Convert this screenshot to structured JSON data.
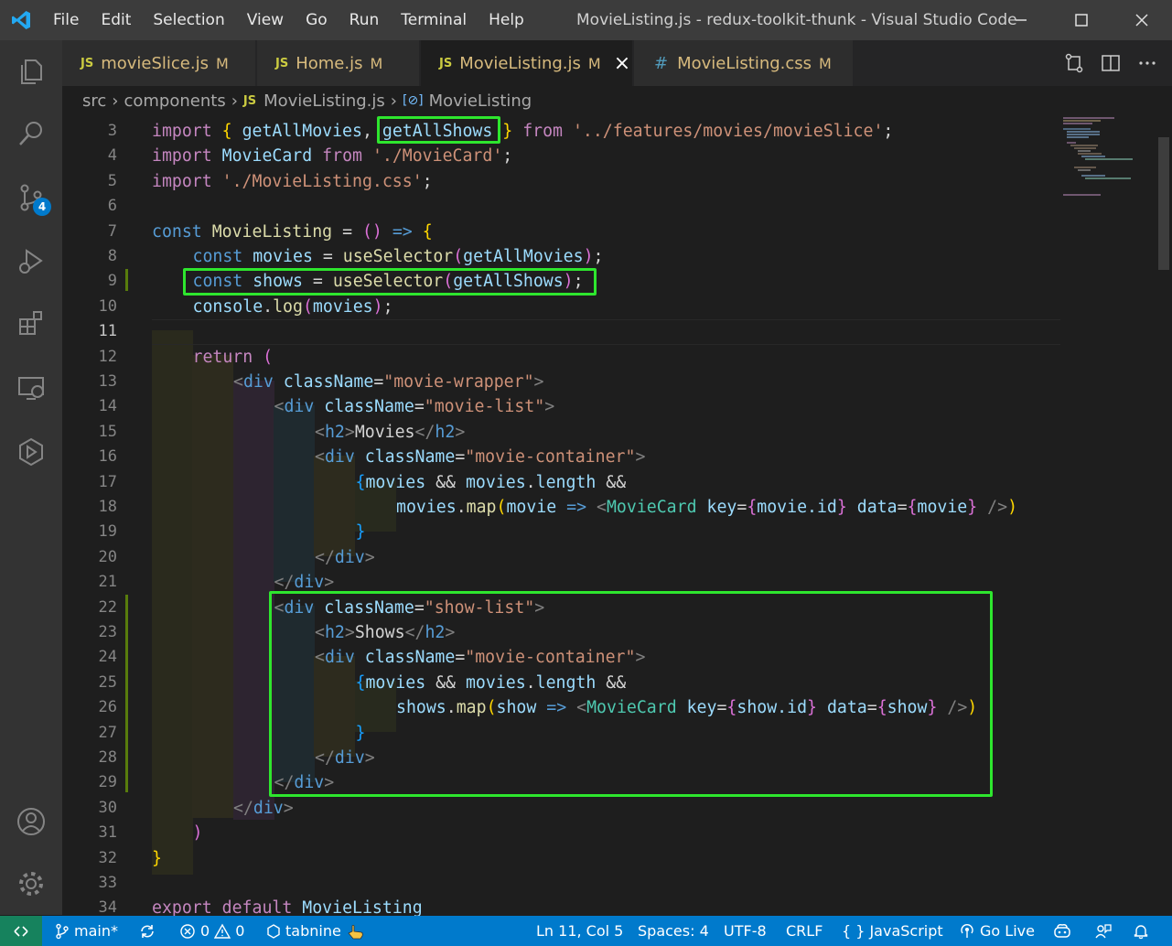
{
  "window": {
    "title": "MovieListing.js - redux-toolkit-thunk - Visual Studio Code"
  },
  "menu": [
    "File",
    "Edit",
    "Selection",
    "View",
    "Go",
    "Run",
    "Terminal",
    "Help"
  ],
  "activity_bar": {
    "source_control_badge": "4"
  },
  "tabs": [
    {
      "icon": "JS",
      "label": "movieSlice.js",
      "status": "M",
      "active": false
    },
    {
      "icon": "JS",
      "label": "Home.js",
      "status": "M",
      "active": false
    },
    {
      "icon": "JS",
      "label": "MovieListing.js",
      "status": "M",
      "active": true
    },
    {
      "icon": "#",
      "label": "MovieListing.css",
      "status": "M",
      "active": false
    }
  ],
  "breadcrumb": {
    "parts": [
      "src",
      "components",
      "MovieListing.js",
      "MovieListing"
    ],
    "file_icon": "JS"
  },
  "editor": {
    "current_line": 11,
    "line_numbers": [
      "3",
      "4",
      "5",
      "6",
      "7",
      "8",
      "9",
      "10",
      "11",
      "12",
      "13",
      "14",
      "15",
      "16",
      "17",
      "18",
      "19",
      "20",
      "21",
      "22",
      "23",
      "24",
      "25",
      "26",
      "27",
      "28",
      "29",
      "30",
      "31",
      "32",
      "33",
      "34"
    ],
    "code": {
      "l3_import": "import",
      "l3_open": "{",
      "l3_getAllMovies": "getAllMovies",
      "l3_comma": ",",
      "l3_getAllShows": "getAllShows",
      "l3_close": "}",
      "l3_from": "from",
      "l3_path": "'../features/movies/movieSlice'",
      "l3_semi": ";",
      "l4_import": "import",
      "l4_name": "MovieCard",
      "l4_from": "from",
      "l4_path": "'./MovieCard'",
      "l4_semi": ";",
      "l5_import": "import",
      "l5_path": "'./MovieListing.css'",
      "l5_semi": ";",
      "l7_const": "const",
      "l7_name": "MovieListing",
      "l7_eq": "=",
      "l7_parens": "()",
      "l7_arrow": "=>",
      "l7_brace": "{",
      "l8_const": "const",
      "l8_var": "movies",
      "l8_eq": "=",
      "l8_fn": "useSelector",
      "l8_arg": "getAllMovies",
      "l8_end": ");",
      "l9_const": "const",
      "l9_var": "shows",
      "l9_eq": "=",
      "l9_fn": "useSelector",
      "l9_arg": "getAllShows",
      "l9_end": ");",
      "l10_console": "console",
      "l10_log": "log",
      "l10_arg": "movies",
      "l10_end": ");",
      "l12_return": "return",
      "l12_paren": "(",
      "l13_class": "\"movie-wrapper\"",
      "l14_class": "\"movie-list\"",
      "l15_text": "Movies",
      "l16_class": "\"movie-container\"",
      "l17_movies": "movies",
      "l17_and": "&&",
      "l17_movies2": "movies",
      "l17_length": "length",
      "l17_and2": "&&",
      "l18_movies": "movies",
      "l18_map": "map",
      "l18_param": "movie",
      "l18_arrow": "=>",
      "l18_comp": "MovieCard",
      "l18_key": "key",
      "l18_keyval": "movie.id",
      "l18_data": "data",
      "l18_dataval": "movie",
      "l19_brace": "}",
      "l22_class": "\"show-list\"",
      "l23_text": "Shows",
      "l24_class": "\"movie-container\"",
      "l25_movies": "movies",
      "l25_and": "&&",
      "l25_movies2": "movies",
      "l25_length": "length",
      "l25_and2": "&&",
      "l26_shows": "shows",
      "l26_map": "map",
      "l26_param": "show",
      "l26_arrow": "=>",
      "l26_comp": "MovieCard",
      "l26_key": "key",
      "l26_keyval": "show.id",
      "l26_data": "data",
      "l26_dataval": "show",
      "l27_brace": "}",
      "l31_paren": ")",
      "l32_brace": "}",
      "l34_export": "export",
      "l34_default": "default",
      "l34_name": "MovieListing",
      "tag_div": "div",
      "tag_h2": "h2",
      "attr_className": "className"
    }
  },
  "status_bar": {
    "branch": "main*",
    "errors": "0",
    "warnings": "0",
    "tabnine": "tabnine",
    "cursor": "Ln 11, Col 5",
    "spaces": "Spaces: 4",
    "encoding": "UTF-8",
    "eol": "CRLF",
    "language": "JavaScript",
    "go_live": "Go Live"
  },
  "colors": {
    "status_bar": "#007acc",
    "highlight_box": "#2ee62e",
    "activity_bar": "#333333",
    "editor_bg": "#1e1e1e"
  }
}
